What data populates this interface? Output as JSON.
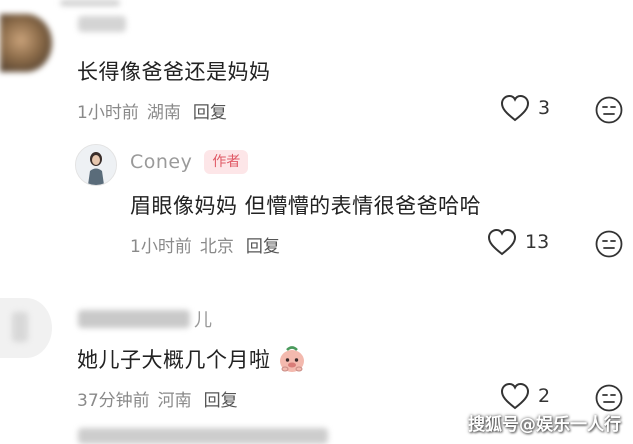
{
  "comments": [
    {
      "text": "长得像爸爸还是妈妈",
      "time": "1小时前",
      "location": "湖南",
      "reply_label": "回复",
      "likes": "3",
      "reply": {
        "username": "Coney",
        "badge": "作者",
        "text": "眉眼像妈妈 但懵懵的表情很爸爸哈哈",
        "time": "1小时前",
        "location": "北京",
        "reply_label": "回复",
        "likes": "13"
      }
    },
    {
      "username_suffix": "儿",
      "text": "她儿子大概几个月啦",
      "time": "37分钟前",
      "location": "河南",
      "reply_label": "回复",
      "likes": "2"
    }
  ],
  "watermark": "搜狐号@娱乐一人行",
  "colors": {
    "badge_text": "#e05a66",
    "badge_bg": "#fde6e8",
    "meta_gray": "#8a8a8a"
  },
  "icons": [
    "heart-icon",
    "reaction-face-icon",
    "emoji-sticker"
  ]
}
